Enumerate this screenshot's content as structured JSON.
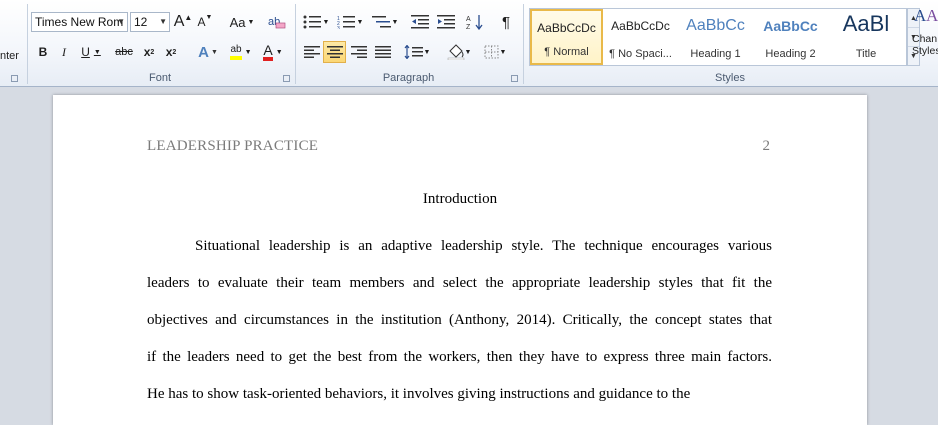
{
  "ribbon": {
    "clipboard": {
      "paste_label_fragment": "nter"
    },
    "font": {
      "group_label": "Font",
      "font_name": "Times New Rom",
      "font_size": "12",
      "grow": "A",
      "shrink": "A",
      "change_case": "Aa",
      "bold": "B",
      "italic": "I",
      "underline": "U",
      "strike": "abc",
      "subscript": "x",
      "superscript": "x",
      "text_effects": "A",
      "highlight": "ab",
      "font_color": "A"
    },
    "paragraph": {
      "group_label": "Paragraph",
      "pilcrow": "¶"
    },
    "styles": {
      "group_label": "Styles",
      "items": [
        {
          "preview": "AaBbCcDc",
          "name": "¶ Normal"
        },
        {
          "preview": "AaBbCcDc",
          "name": "¶ No Spaci..."
        },
        {
          "preview": "AaBbCc",
          "name": "Heading 1"
        },
        {
          "preview": "AaBbCc",
          "name": "Heading 2"
        },
        {
          "preview": "AaBl",
          "name": "Title"
        }
      ],
      "change_styles_line1": "Chan",
      "change_styles_line2": "Styles"
    },
    "colors": {
      "accent": "#e9b949",
      "font_red": "#e02020",
      "highlight_yellow": "#ffff00",
      "heading_blue": "#4f81bd"
    }
  },
  "document": {
    "running_head": "LEADERSHIP PRACTICE",
    "page_number": "2",
    "title": "Introduction",
    "lines": [
      "Situational leadership is an adaptive leadership style. The technique encourages various",
      "leaders to evaluate their team members and select the appropriate leadership styles that fit the",
      "objectives and circumstances in the institution (Anthony, 2014). Critically, the concept states that",
      "if the leaders need to get the best from the workers, then they have to express three main factors.",
      "He has to show task-oriented behaviors, it involves giving instructions and guidance to the"
    ]
  }
}
